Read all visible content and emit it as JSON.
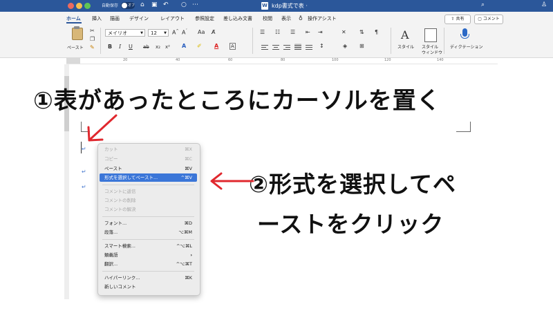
{
  "titlebar": {
    "autosave_label": "自動保存",
    "autosave_state": "オフ",
    "doc_icon": "W",
    "doc_title": "kdp書式で表 ·",
    "icons": [
      "home-icon",
      "save-icon",
      "undo-icon",
      "redo-icon",
      "more-icon",
      "search-icon",
      "profile-icon"
    ]
  },
  "tabs": [
    {
      "label": "ホーム"
    },
    {
      "label": "挿入"
    },
    {
      "label": "描画"
    },
    {
      "label": "デザイン"
    },
    {
      "label": "レイアウト"
    },
    {
      "label": "参照設定"
    },
    {
      "label": "差し込み文書"
    },
    {
      "label": "校閲"
    },
    {
      "label": "表示"
    },
    {
      "label": "操作アシスト"
    }
  ],
  "header_buttons": {
    "share": "共有",
    "comment": "コメント"
  },
  "ribbon": {
    "paste_label": "ペースト",
    "font_name": "メイリオ",
    "font_size": "12",
    "styles_label": "スタイル",
    "styles_pane_line1": "スタイル",
    "styles_pane_line2": "ウィンドウ",
    "dictation_label": "ディクテーション"
  },
  "ruler": {
    "numbers": [
      "20",
      "40",
      "60",
      "80",
      "100",
      "120",
      "140"
    ]
  },
  "annotations": {
    "step1": "①表があったところにカーソルを置く",
    "step2_line1": "②形式を選択してペ",
    "step2_line2": "ーストをクリック",
    "accent_color": "#e0282e"
  },
  "context_menu": {
    "items": [
      {
        "label": "カット",
        "shortcut": "⌘X",
        "disabled": true
      },
      {
        "label": "コピー",
        "shortcut": "⌘C",
        "disabled": true
      },
      {
        "label": "ペースト",
        "shortcut": "⌘V",
        "disabled": false
      },
      {
        "label": "形式を選択してペースト...",
        "shortcut": "^⌘V",
        "disabled": false,
        "highlighted": true
      },
      {
        "label": "コメントに返信",
        "shortcut": "",
        "disabled": true
      },
      {
        "label": "コメントの削除",
        "shortcut": "",
        "disabled": true
      },
      {
        "label": "コメントの解決",
        "shortcut": "",
        "disabled": true
      },
      {
        "label": "フォント...",
        "shortcut": "⌘D",
        "disabled": false
      },
      {
        "label": "段落...",
        "shortcut": "⌥⌘M",
        "disabled": false
      },
      {
        "label": "スマート検索...",
        "shortcut": "^⌥⌘L",
        "disabled": false
      },
      {
        "label": "類義語",
        "shortcut": "›",
        "disabled": false
      },
      {
        "label": "翻訳...",
        "shortcut": "^⌥⌘T",
        "disabled": false
      },
      {
        "label": "ハイパーリンク...",
        "shortcut": "⌘K",
        "disabled": false
      },
      {
        "label": "新しいコメント",
        "shortcut": "",
        "disabled": false
      }
    ]
  },
  "colors": {
    "word_blue": "#2b579a",
    "menu_highlight": "#3b76d8"
  }
}
